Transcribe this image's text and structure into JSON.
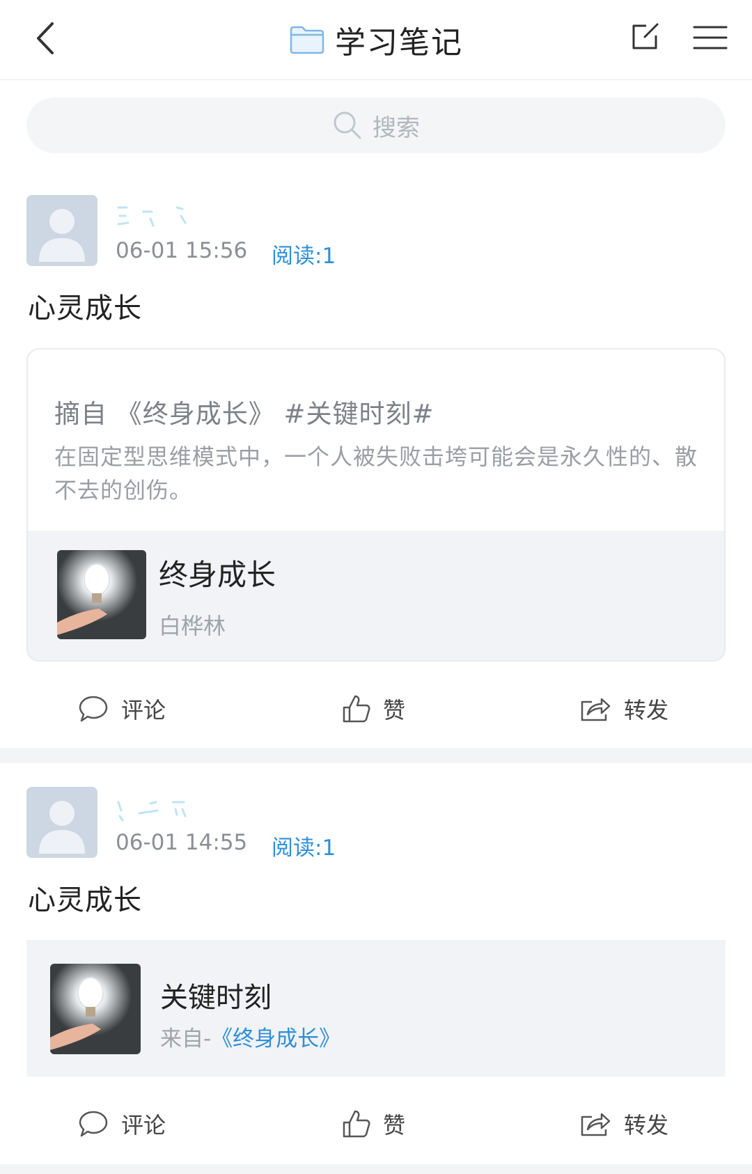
{
  "header": {
    "title": "学习笔记",
    "icons": {
      "back": "chevron-left-icon",
      "folder": "folder-icon",
      "edit": "edit-icon",
      "menu": "menu-icon"
    }
  },
  "search": {
    "placeholder": "搜索",
    "icon": "search-icon"
  },
  "posts": [
    {
      "username": "",
      "time": "06-01 15:56",
      "reads": "阅读:1",
      "title": "心灵成长",
      "excerpt": {
        "heading": "摘自 《终身成长》 #关键时刻#",
        "body": "在固定型思维模式中，一个人被失败击垮可能会是永久性的、散不去的创伤。",
        "book_title": "终身成长",
        "book_author": "白桦林"
      },
      "actions": {
        "comment": "评论",
        "like": "赞",
        "share": "转发"
      }
    },
    {
      "username": "",
      "time": "06-01 14:55",
      "reads": "阅读:1",
      "title": "心灵成长",
      "chapter": {
        "name": "关键时刻",
        "from_prefix": "来自-",
        "from_book": "《终身成长》"
      },
      "actions": {
        "comment": "评论",
        "like": "赞",
        "share": "转发"
      }
    }
  ],
  "colors": {
    "accent": "#2f8fd8",
    "divider": "#f2f4f6",
    "card_bg": "#f1f3f6"
  }
}
